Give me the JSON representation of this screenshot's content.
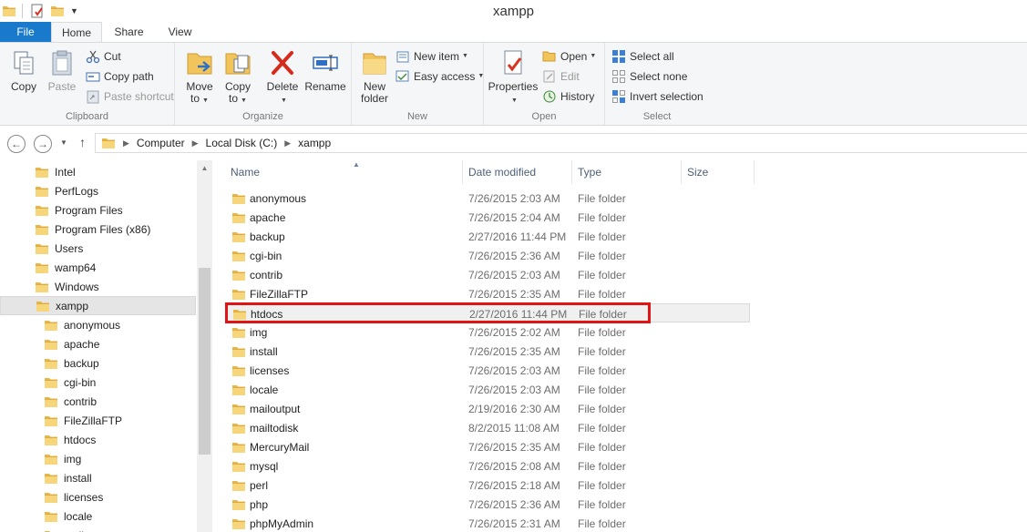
{
  "window": {
    "title": "xampp"
  },
  "tabs": {
    "file": "File",
    "home": "Home",
    "share": "Share",
    "view": "View"
  },
  "ribbon": {
    "clipboard": {
      "label": "Clipboard",
      "copy": "Copy",
      "paste": "Paste",
      "cut": "Cut",
      "copy_path": "Copy path",
      "paste_shortcut": "Paste shortcut"
    },
    "organize": {
      "label": "Organize",
      "move_to_1": "Move",
      "move_to_2": "to",
      "copy_to_1": "Copy",
      "copy_to_2": "to",
      "delete": "Delete",
      "rename": "Rename"
    },
    "new": {
      "label": "New",
      "new_folder_1": "New",
      "new_folder_2": "folder",
      "new_item": "New item",
      "easy_access": "Easy access"
    },
    "open": {
      "label": "Open",
      "properties": "Properties",
      "open": "Open",
      "edit": "Edit",
      "history": "History"
    },
    "select": {
      "label": "Select",
      "select_all": "Select all",
      "select_none": "Select none",
      "invert_selection": "Invert selection"
    }
  },
  "address": {
    "segments": [
      "Computer",
      "Local Disk (C:)",
      "xampp"
    ]
  },
  "nav": {
    "items": [
      {
        "label": "Intel",
        "level": 1
      },
      {
        "label": "PerfLogs",
        "level": 1
      },
      {
        "label": "Program Files",
        "level": 1
      },
      {
        "label": "Program Files (x86)",
        "level": 1
      },
      {
        "label": "Users",
        "level": 1
      },
      {
        "label": "wamp64",
        "level": 1
      },
      {
        "label": "Windows",
        "level": 1
      },
      {
        "label": "xampp",
        "level": 1,
        "selected": true
      },
      {
        "label": "anonymous",
        "level": 2
      },
      {
        "label": "apache",
        "level": 2
      },
      {
        "label": "backup",
        "level": 2
      },
      {
        "label": "cgi-bin",
        "level": 2
      },
      {
        "label": "contrib",
        "level": 2
      },
      {
        "label": "FileZillaFTP",
        "level": 2
      },
      {
        "label": "htdocs",
        "level": 2
      },
      {
        "label": "img",
        "level": 2
      },
      {
        "label": "install",
        "level": 2
      },
      {
        "label": "licenses",
        "level": 2
      },
      {
        "label": "locale",
        "level": 2
      },
      {
        "label": "mailoutput",
        "level": 2
      }
    ]
  },
  "columns": {
    "name": "Name",
    "date": "Date modified",
    "type": "Type",
    "size": "Size"
  },
  "files": [
    {
      "name": "anonymous",
      "date": "7/26/2015 2:03 AM",
      "type": "File folder"
    },
    {
      "name": "apache",
      "date": "7/26/2015 2:04 AM",
      "type": "File folder"
    },
    {
      "name": "backup",
      "date": "2/27/2016 11:44 PM",
      "type": "File folder"
    },
    {
      "name": "cgi-bin",
      "date": "7/26/2015 2:36 AM",
      "type": "File folder"
    },
    {
      "name": "contrib",
      "date": "7/26/2015 2:03 AM",
      "type": "File folder"
    },
    {
      "name": "FileZillaFTP",
      "date": "7/26/2015 2:35 AM",
      "type": "File folder"
    },
    {
      "name": "htdocs",
      "date": "2/27/2016 11:44 PM",
      "type": "File folder",
      "hover": true,
      "highlighted": true
    },
    {
      "name": "img",
      "date": "7/26/2015 2:02 AM",
      "type": "File folder"
    },
    {
      "name": "install",
      "date": "7/26/2015 2:35 AM",
      "type": "File folder"
    },
    {
      "name": "licenses",
      "date": "7/26/2015 2:03 AM",
      "type": "File folder"
    },
    {
      "name": "locale",
      "date": "7/26/2015 2:03 AM",
      "type": "File folder"
    },
    {
      "name": "mailoutput",
      "date": "2/19/2016 2:30 AM",
      "type": "File folder"
    },
    {
      "name": "mailtodisk",
      "date": "8/2/2015 11:08 AM",
      "type": "File folder"
    },
    {
      "name": "MercuryMail",
      "date": "7/26/2015 2:35 AM",
      "type": "File folder"
    },
    {
      "name": "mysql",
      "date": "7/26/2015 2:08 AM",
      "type": "File folder"
    },
    {
      "name": "perl",
      "date": "7/26/2015 2:18 AM",
      "type": "File folder"
    },
    {
      "name": "php",
      "date": "7/26/2015 2:36 AM",
      "type": "File folder"
    },
    {
      "name": "phpMyAdmin",
      "date": "7/26/2015 2:31 AM",
      "type": "File folder"
    }
  ],
  "colors": {
    "file_tab": "#1979ca",
    "highlight": "#e01414",
    "folder": "#e8b74a",
    "header_text": "#4c607a"
  }
}
